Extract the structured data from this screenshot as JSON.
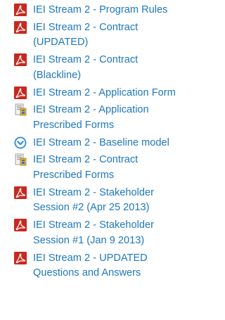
{
  "documents": [
    {
      "label": "IEI Stream 2 - Program Rules",
      "icon": "pdf-icon"
    },
    {
      "label": "IEI Stream 2 - Contract (UPDATED)",
      "icon": "pdf-icon"
    },
    {
      "label": "IEI Stream 2 - Contract (Blackline)",
      "icon": "pdf-icon"
    },
    {
      "label": "IEI Stream 2 - Application Form",
      "icon": "pdf-icon"
    },
    {
      "label": "IEI Stream 2 - Application Prescribed Forms",
      "icon": "archive-icon"
    },
    {
      "label": "IEI Stream 2 - Baseline model",
      "icon": "download-icon"
    },
    {
      "label": "IEI Stream 2 - Contract Prescribed Forms",
      "icon": "archive-icon"
    },
    {
      "label": "IEI Stream 2 - Stakeholder Session #2 (Apr 25 2013)",
      "icon": "pdf-icon"
    },
    {
      "label": "IEI Stream 2 - Stakeholder Session #1 (Jan 9 2013)",
      "icon": "pdf-icon"
    },
    {
      "label": "IEI Stream 2 - UPDATED Questions and Answers",
      "icon": "pdf-icon"
    }
  ],
  "colors": {
    "link": "#1e78be",
    "pdf": "#c8281e",
    "download": "#3b8fd6"
  }
}
